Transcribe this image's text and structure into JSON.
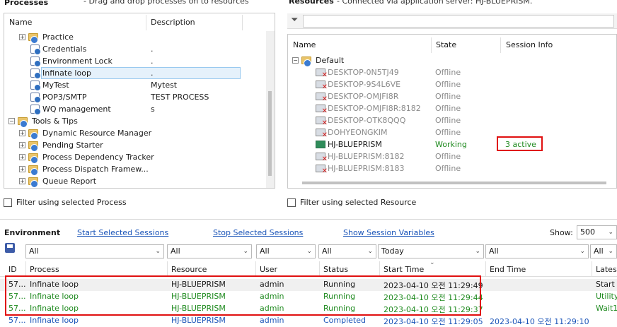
{
  "processes": {
    "title": "Processes",
    "hint": "- Drag and drop processes on to resources",
    "col_name": "Name",
    "col_description": "Description",
    "items": [
      {
        "name": "Practice",
        "description": "",
        "kind": "folder",
        "level": 1
      },
      {
        "name": "Credentials",
        "description": ".",
        "kind": "process",
        "level": 2
      },
      {
        "name": "Environment Lock",
        "description": ".",
        "kind": "process",
        "level": 2
      },
      {
        "name": "Infinate loop",
        "description": ".",
        "kind": "process",
        "level": 2,
        "selected": true
      },
      {
        "name": "MyTest",
        "description": "Mytest",
        "kind": "process",
        "level": 2
      },
      {
        "name": "POP3/SMTP",
        "description": "TEST PROCESS",
        "kind": "process",
        "level": 2
      },
      {
        "name": "WQ management",
        "description": "s",
        "kind": "process",
        "level": 2
      },
      {
        "name": "Tools & Tips",
        "description": "",
        "kind": "folder",
        "level": 0
      },
      {
        "name": "Dynamic Resource Manager",
        "description": "",
        "kind": "folder",
        "level": 1
      },
      {
        "name": "Pending Starter",
        "description": "",
        "kind": "folder",
        "level": 1
      },
      {
        "name": "Process Dependency Tracker",
        "description": "",
        "kind": "folder",
        "level": 1
      },
      {
        "name": "Process Dispatch Framew...",
        "description": "",
        "kind": "folder",
        "level": 1
      },
      {
        "name": "Queue Report",
        "description": "",
        "kind": "folder",
        "level": 1
      }
    ],
    "filter_label": "Filter using selected Process"
  },
  "resources": {
    "title": "Resources",
    "hint": "- Connected via application server: HJ-BLUEPRISM.",
    "col_name": "Name",
    "col_state": "State",
    "col_session": "Session Info",
    "group": "Default",
    "items": [
      {
        "name": "DESKTOP-0N5TJ49",
        "state": "Offline",
        "session": ""
      },
      {
        "name": "DESKTOP-9S4L6VE",
        "state": "Offline",
        "session": ""
      },
      {
        "name": "DESKTOP-OMJFI8R",
        "state": "Offline",
        "session": ""
      },
      {
        "name": "DESKTOP-OMJFI8R:8182",
        "state": "Offline",
        "session": ""
      },
      {
        "name": "DESKTOP-OTK8QQQ",
        "state": "Offline",
        "session": ""
      },
      {
        "name": "DOHYEONGKIM",
        "state": "Offline",
        "session": ""
      },
      {
        "name": "HJ-BLUEPRISM",
        "state": "Working",
        "session": "3 active"
      },
      {
        "name": "HJ-BLUEPRISM:8182",
        "state": "Offline",
        "session": ""
      },
      {
        "name": "HJ-BLUEPRISM:8183",
        "state": "Offline",
        "session": ""
      }
    ],
    "filter_label": "Filter using selected Resource"
  },
  "environment": {
    "title": "Environment",
    "start_link": "Start Selected Sessions",
    "stop_link": "Stop Selected Sessions",
    "vars_link": "Show Session Variables",
    "show_label": "Show:",
    "show_value": "500",
    "filters": [
      "All",
      "All",
      "All",
      "All",
      "Today",
      "All",
      "All"
    ],
    "columns": [
      "ID",
      "Process",
      "Resource",
      "User",
      "Status",
      "Start Time",
      "End Time",
      "Latest"
    ],
    "rows": [
      {
        "id": "57...",
        "process": "Infinate loop",
        "resource": "HJ-BLUEPRISM",
        "user": "admin",
        "status": "Running",
        "start": "2023-04-10 오전 11:29:49",
        "end": "",
        "latest": "Start",
        "color": "black"
      },
      {
        "id": "57...",
        "process": "Infinate loop",
        "resource": "HJ-BLUEPRISM",
        "user": "admin",
        "status": "Running",
        "start": "2023-04-10 오전 11:29:44",
        "end": "",
        "latest": "Utility",
        "color": "green"
      },
      {
        "id": "57...",
        "process": "Infinate loop",
        "resource": "HJ-BLUEPRISM",
        "user": "admin",
        "status": "Running",
        "start": "2023-04-10 오전 11:29:37",
        "end": "",
        "latest": "Wait1",
        "color": "green"
      },
      {
        "id": "57...",
        "process": "Infinate loop",
        "resource": "HJ-BLUEPRISM",
        "user": "admin",
        "status": "Completed",
        "start": "2023-04-10 오전 11:29:05",
        "end": "2023-04-10 오전 11:29:10",
        "latest": "",
        "color": "blue"
      }
    ]
  },
  "colors": {
    "accent_red": "#e01010",
    "working_green": "#1e8a1e",
    "link_blue": "#1a54b8"
  }
}
